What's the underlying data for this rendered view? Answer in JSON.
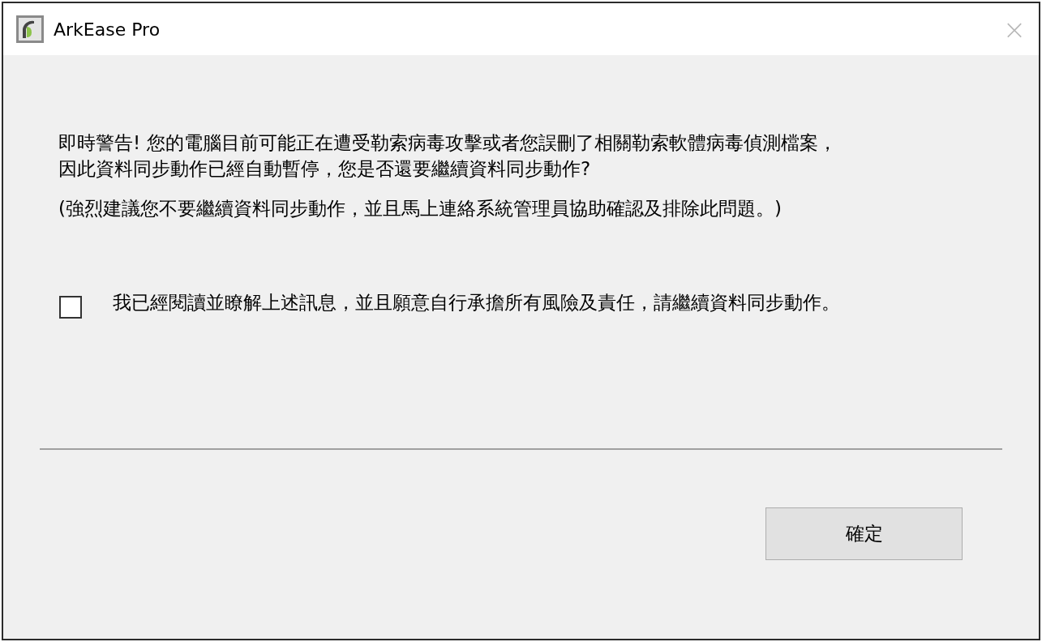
{
  "window": {
    "title": "ArkEase Pro",
    "close": "×"
  },
  "message_lines": [
    "即時警告! 您的電腦目前可能正在遭受勒索病毒攻擊或者您誤刪了相關勒索軟體病毒偵測檔案，",
    "因此資料同步動作已經自動暫停，您是否還要繼續資料同步動作?"
  ],
  "advice": "(強烈建議您不要繼續資料同步動作，並且馬上連絡系統管理員協助確認及排除此問題。)",
  "acknowledge": {
    "label": "我已經閱讀並瞭解上述訊息，並且願意自行承擔所有風險及責任，請繼續資料同步動作。",
    "checked": false
  },
  "buttons": [
    "確定"
  ]
}
